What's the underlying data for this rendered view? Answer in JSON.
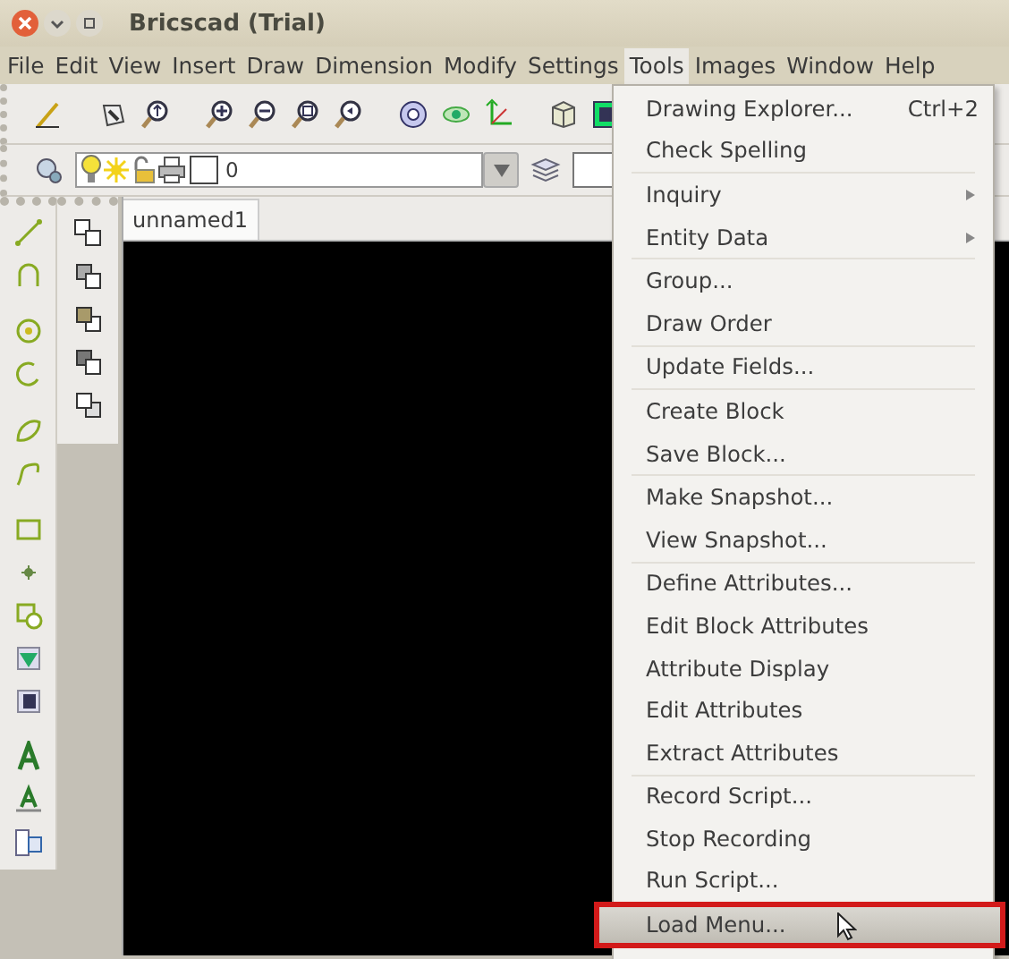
{
  "window": {
    "title": "Bricscad (Trial)"
  },
  "menubar": [
    {
      "label": "File",
      "selected": false
    },
    {
      "label": "Edit",
      "selected": false
    },
    {
      "label": "View",
      "selected": false
    },
    {
      "label": "Insert",
      "selected": false
    },
    {
      "label": "Draw",
      "selected": false
    },
    {
      "label": "Dimension",
      "selected": false
    },
    {
      "label": "Modify",
      "selected": false
    },
    {
      "label": "Settings",
      "selected": false
    },
    {
      "label": "Tools",
      "selected": true
    },
    {
      "label": "Images",
      "selected": false
    },
    {
      "label": "Window",
      "selected": false
    },
    {
      "label": "Help",
      "selected": false
    }
  ],
  "layer_combo": {
    "value": "0"
  },
  "tabs": [
    {
      "label": "unnamed1",
      "selected": true
    }
  ],
  "tools_menu": [
    [
      {
        "label": "Drawing Explorer...",
        "shortcut": "Ctrl+2",
        "submenu": false,
        "selected": false,
        "marked": false
      },
      {
        "label": "Check Spelling",
        "submenu": false,
        "selected": false,
        "marked": false
      }
    ],
    [
      {
        "label": "Inquiry",
        "submenu": true,
        "selected": false,
        "marked": false
      },
      {
        "label": "Entity Data",
        "submenu": true,
        "selected": false,
        "marked": false
      }
    ],
    [
      {
        "label": "Group...",
        "submenu": false,
        "selected": false,
        "marked": false
      },
      {
        "label": "Draw Order",
        "submenu": false,
        "selected": false,
        "marked": false
      }
    ],
    [
      {
        "label": "Update Fields...",
        "submenu": false,
        "selected": false,
        "marked": false
      }
    ],
    [
      {
        "label": "Create Block",
        "submenu": false,
        "selected": false,
        "marked": false
      },
      {
        "label": "Save Block...",
        "submenu": false,
        "selected": false,
        "marked": false
      }
    ],
    [
      {
        "label": "Make Snapshot...",
        "submenu": false,
        "selected": false,
        "marked": false
      },
      {
        "label": "View Snapshot...",
        "submenu": false,
        "selected": false,
        "marked": false
      }
    ],
    [
      {
        "label": "Define Attributes...",
        "submenu": false,
        "selected": false,
        "marked": false
      },
      {
        "label": "Edit Block Attributes",
        "submenu": false,
        "selected": false,
        "marked": false
      },
      {
        "label": "Attribute Display",
        "submenu": false,
        "selected": false,
        "marked": false
      },
      {
        "label": "Edit Attributes",
        "submenu": false,
        "selected": false,
        "marked": false
      },
      {
        "label": "Extract Attributes",
        "submenu": false,
        "selected": false,
        "marked": false
      }
    ],
    [
      {
        "label": "Record Script...",
        "submenu": false,
        "selected": false,
        "marked": false
      },
      {
        "label": "Stop Recording",
        "submenu": false,
        "selected": false,
        "marked": false
      },
      {
        "label": "Run Script...",
        "submenu": false,
        "selected": false,
        "marked": false
      }
    ],
    [
      {
        "label": "Load Menu...",
        "submenu": false,
        "selected": true,
        "marked": true
      }
    ]
  ]
}
